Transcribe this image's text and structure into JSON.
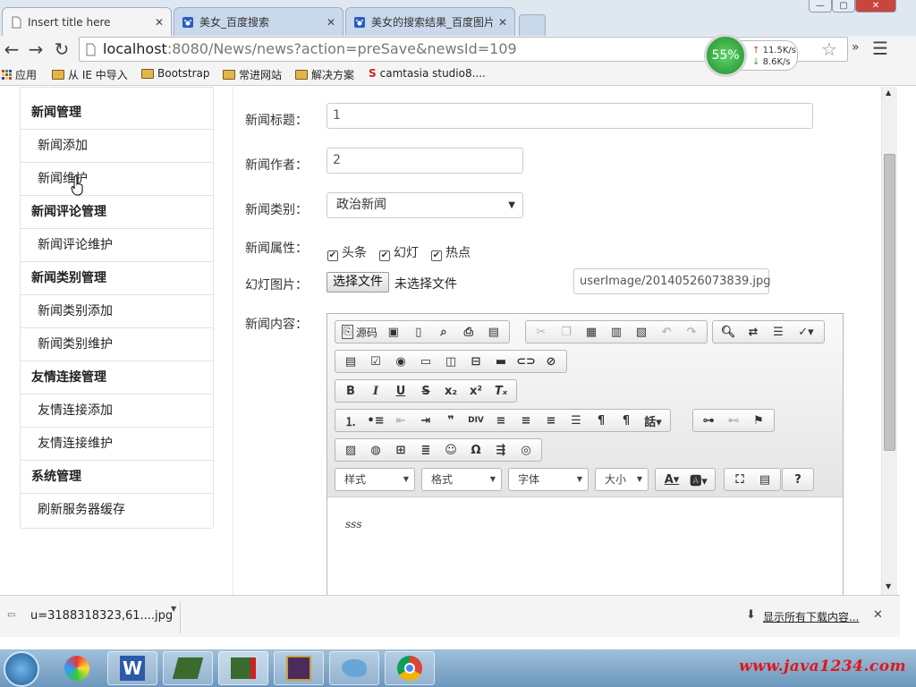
{
  "browser": {
    "tabs": [
      {
        "label": "Insert title here",
        "active": true
      },
      {
        "label": "美女_百度搜索",
        "active": false
      },
      {
        "label": "美女的搜索结果_百度图片",
        "active": false
      }
    ],
    "url_host": "localhost",
    "url_rest": ":8080/News/news?action=preSave&newsId=109",
    "net_meter": {
      "percent": "55%",
      "up": "11.5K/s",
      "down": "8.6K/s"
    },
    "bookmarks": [
      "应用",
      "从 IE 中导入",
      "Bootstrap",
      "常进网站",
      "解决方案",
      "camtasia studio8...."
    ]
  },
  "sidebar": {
    "items": [
      {
        "label": "新闻管理",
        "type": "header"
      },
      {
        "label": "新闻添加",
        "type": "item"
      },
      {
        "label": "新闻维护",
        "type": "item"
      },
      {
        "label": "新闻评论管理",
        "type": "header"
      },
      {
        "label": "新闻评论维护",
        "type": "item"
      },
      {
        "label": "新闻类别管理",
        "type": "header"
      },
      {
        "label": "新闻类别添加",
        "type": "item"
      },
      {
        "label": "新闻类别维护",
        "type": "item"
      },
      {
        "label": "友情连接管理",
        "type": "header"
      },
      {
        "label": "友情连接添加",
        "type": "item"
      },
      {
        "label": "友情连接维护",
        "type": "item"
      },
      {
        "label": "系统管理",
        "type": "header"
      },
      {
        "label": "刷新服务器缓存",
        "type": "item"
      }
    ]
  },
  "form": {
    "title_label": "新闻标题：",
    "title_value": "1",
    "author_label": "新闻作者：",
    "author_value": "2",
    "category_label": "新闻类别：",
    "category_value": "政治新闻",
    "attr_label": "新闻属性：",
    "attrs": [
      {
        "label": "头条",
        "checked": true
      },
      {
        "label": "幻灯",
        "checked": true
      },
      {
        "label": "热点",
        "checked": true
      }
    ],
    "slide_label": "幻灯图片：",
    "file_button": "选择文件",
    "file_status": "未选择文件",
    "image_path": "userImage/20140526073839.jpg",
    "content_label": "新闻内容：",
    "content_text": "sss"
  },
  "editor": {
    "source_label": "源码",
    "styles_combo": "样式",
    "format_combo": "格式",
    "font_combo": "字体",
    "size_combo": "大小"
  },
  "downloads": {
    "file": "u=3188318323,61....jpg",
    "show_all": "显示所有下载内容..."
  },
  "taskbar": {
    "watermark": "www.java1234.com"
  }
}
